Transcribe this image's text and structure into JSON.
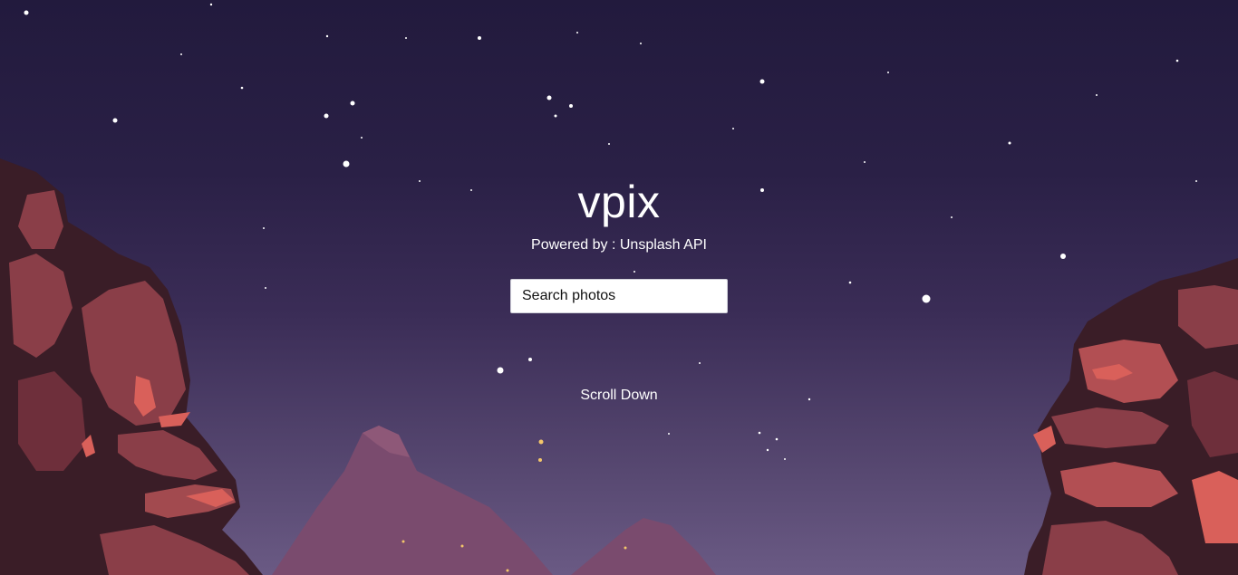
{
  "hero": {
    "title": "vpix",
    "subtitle": "Powered by : Unsplash API",
    "search": {
      "placeholder": "Search photos",
      "value": ""
    },
    "scroll_label": "Scroll Down"
  },
  "colors": {
    "sky_top": "#221a3d",
    "sky_bottom": "#6a5a84",
    "rock_dark": "#3a1d27",
    "rock_mid": "#8a3e48",
    "rock_light": "#d9605a",
    "mountain": "#7a4b6e",
    "text": "#ffffff"
  }
}
